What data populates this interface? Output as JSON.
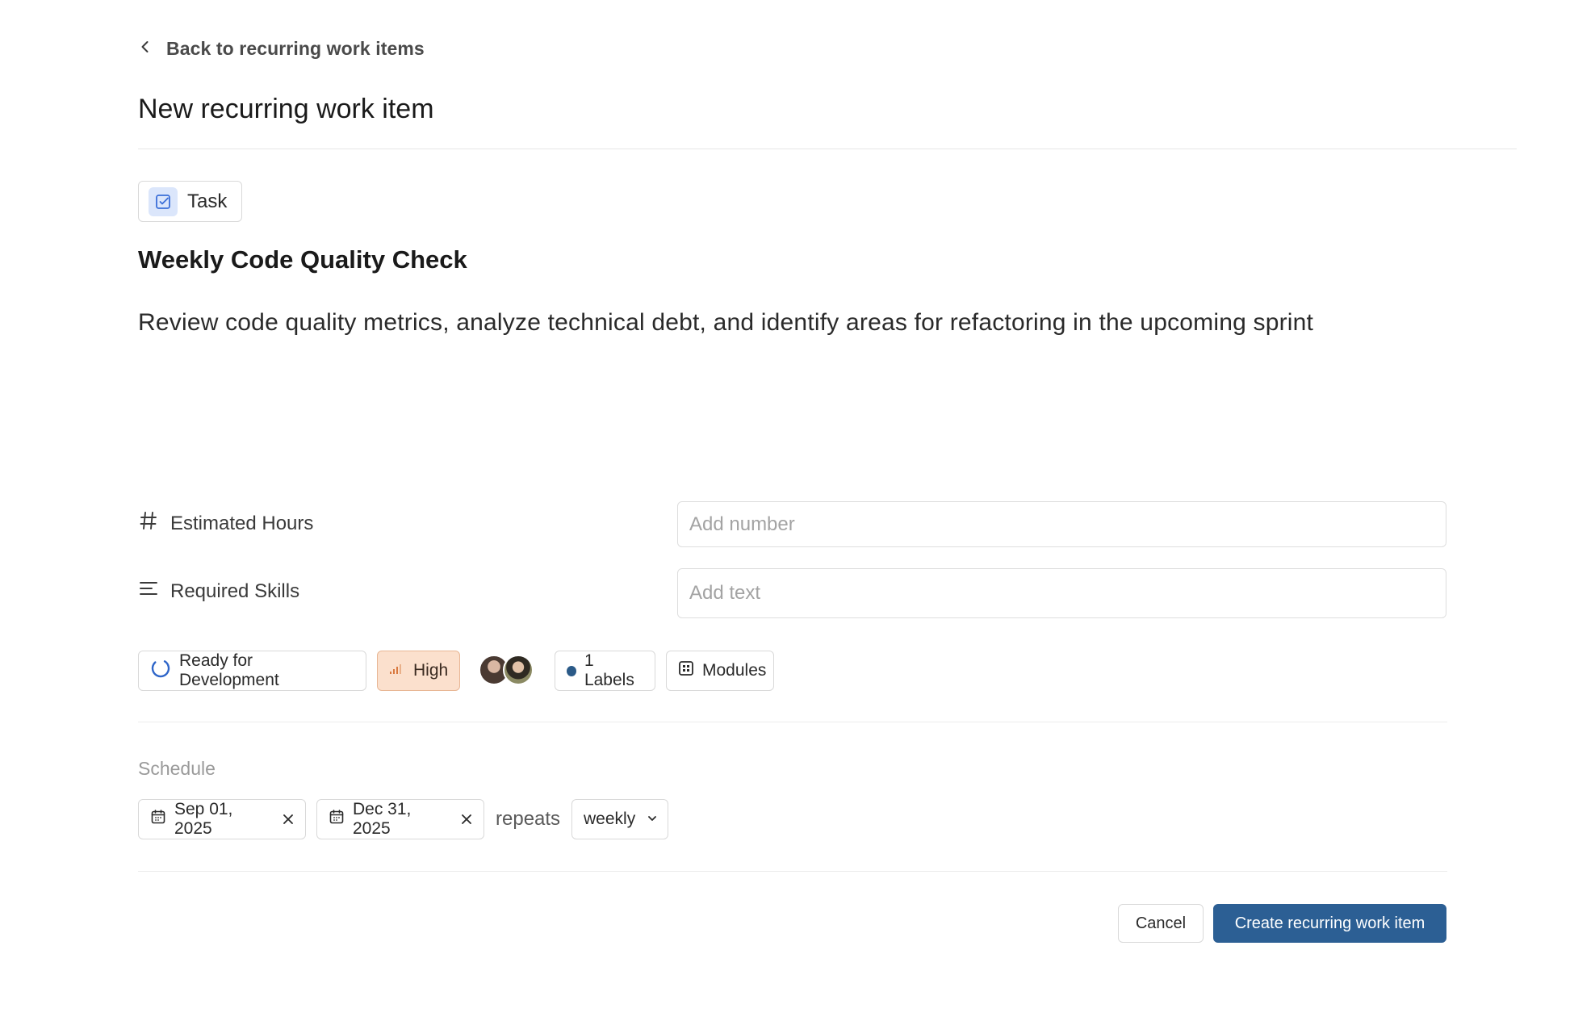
{
  "nav": {
    "back_label": "Back to recurring work items"
  },
  "page": {
    "title": "New recurring work item"
  },
  "work_item": {
    "type_label": "Task",
    "title": "Weekly Code Quality Check",
    "description": "Review code quality metrics, analyze technical debt, and identify areas for refactoring in the upcoming sprint"
  },
  "properties": {
    "estimated_hours": {
      "label": "Estimated Hours",
      "placeholder": "Add number",
      "value": ""
    },
    "required_skills": {
      "label": "Required Skills",
      "placeholder": "Add text",
      "value": ""
    }
  },
  "attributes": {
    "state": "Ready for Development",
    "priority": "High",
    "labels": "1 Labels",
    "modules": "Modules",
    "colors": {
      "priority_bg": "#fbe0cd",
      "label_dot": "#2b5a88",
      "state_icon": "#2f66c9"
    }
  },
  "schedule": {
    "label": "Schedule",
    "start_date": "Sep 01, 2025",
    "end_date": "Dec 31, 2025",
    "repeats_label": "repeats",
    "frequency": "weekly"
  },
  "actions": {
    "cancel_label": "Cancel",
    "create_label": "Create recurring work item",
    "accent": "#2c5f94"
  }
}
